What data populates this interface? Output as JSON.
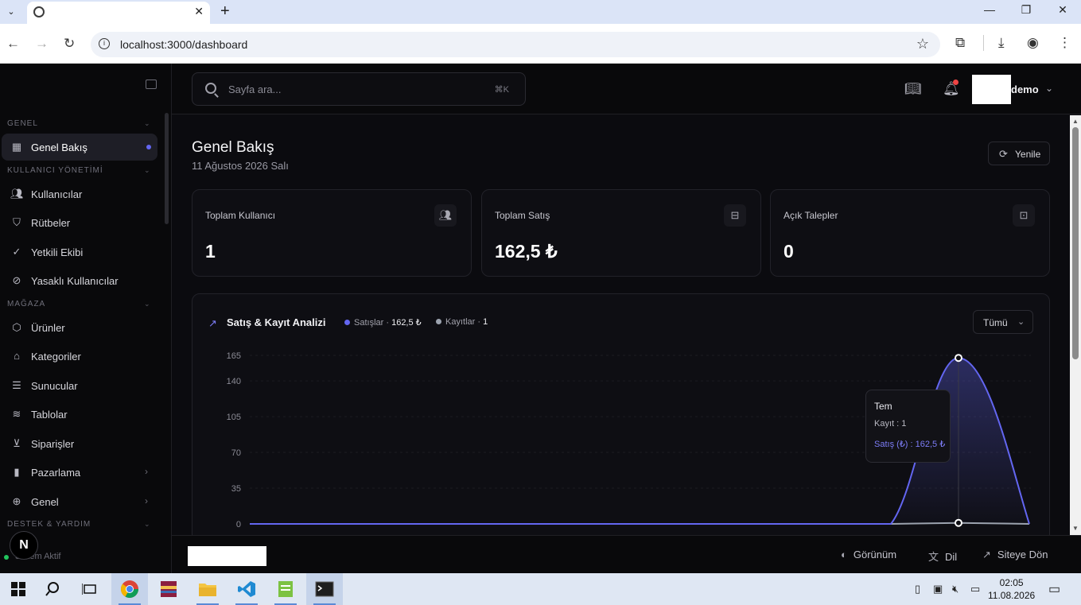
{
  "browser": {
    "url": "localhost:3000/dashboard",
    "tab_close": "✕",
    "new_tab": "+",
    "window_controls": [
      "—",
      "❐",
      "✕"
    ]
  },
  "sidebar": {
    "sections": [
      {
        "label": "GENEL"
      },
      {
        "label": "KULLANICI YÖNETİMİ"
      },
      {
        "label": "MAĞAZA"
      },
      {
        "label": "DESTEK & YARDIM"
      }
    ],
    "items": [
      {
        "label": "Genel Bakış",
        "icon": "grid-icon",
        "active": true
      },
      {
        "label": "Kullanıcılar",
        "icon": "users-icon"
      },
      {
        "label": "Rütbeler",
        "icon": "shield-icon"
      },
      {
        "label": "Yetkili Ekibi",
        "icon": "user-check-icon"
      },
      {
        "label": "Yasaklı Kullanıcılar",
        "icon": "ban-icon"
      },
      {
        "label": "Ürünler",
        "icon": "box-icon"
      },
      {
        "label": "Kategoriler",
        "icon": "tag-icon"
      },
      {
        "label": "Sunucular",
        "icon": "server-icon"
      },
      {
        "label": "Tablolar",
        "icon": "layers-icon"
      },
      {
        "label": "Siparişler",
        "icon": "cart-icon"
      },
      {
        "label": "Pazarlama",
        "icon": "chart-bars-icon",
        "has_children": true
      },
      {
        "label": "Genel",
        "icon": "globe-icon",
        "has_children": true
      }
    ],
    "status": "Sistem Aktif",
    "badge": "N"
  },
  "topbar": {
    "search_placeholder": "Sayfa ara...",
    "search_shortcut": "⌘K",
    "user_name": "demo"
  },
  "page": {
    "title": "Genel Bakış",
    "date": "11 Ağustos 2026 Salı",
    "refresh_label": "Yenile"
  },
  "stats": [
    {
      "title": "Toplam Kullanıcı",
      "value": "1",
      "icon": "users-icon"
    },
    {
      "title": "Toplam Satış",
      "value": "162,5 ₺",
      "icon": "shopping-bag-icon"
    },
    {
      "title": "Açık Talepler",
      "value": "0",
      "icon": "ticket-icon"
    }
  ],
  "chart_section": {
    "title": "Satış & Kayıt Analizi",
    "legend": [
      {
        "name": "Satışlar",
        "value": "162,5 ₺",
        "color": "#6366f1"
      },
      {
        "name": "Kayıtlar",
        "value": "1",
        "color": "#9ca3af"
      }
    ],
    "filter": "Tümü",
    "tooltip": {
      "title": "Tem",
      "row1": "Kayıt : 1",
      "row2": "Satış (₺) : 162,5 ₺"
    }
  },
  "chart_data": {
    "type": "area",
    "y_ticks": [
      "0",
      "35",
      "70",
      "105",
      "140",
      "165"
    ],
    "ylim": [
      0,
      165
    ],
    "series": [
      {
        "name": "Satış (₺)",
        "color": "#6366f1",
        "peak_value": 162.5,
        "peak_label": "Tem"
      },
      {
        "name": "Kayıt",
        "color": "#9ca3af",
        "peak_value": 1,
        "peak_label": "Tem"
      }
    ]
  },
  "footer": {
    "links": [
      {
        "label": "Görünüm",
        "icon": "palette-icon"
      },
      {
        "label": "Dil",
        "icon": "translate-icon"
      },
      {
        "label": "Siteye Dön",
        "icon": "external-link-icon"
      }
    ]
  },
  "taskbar": {
    "time": "02:05",
    "date": "11.08.2026"
  },
  "colors": {
    "accent": "#6366f1",
    "background": "#0b0b0f",
    "notification": "#ef4444",
    "status_green": "#22c55e"
  }
}
